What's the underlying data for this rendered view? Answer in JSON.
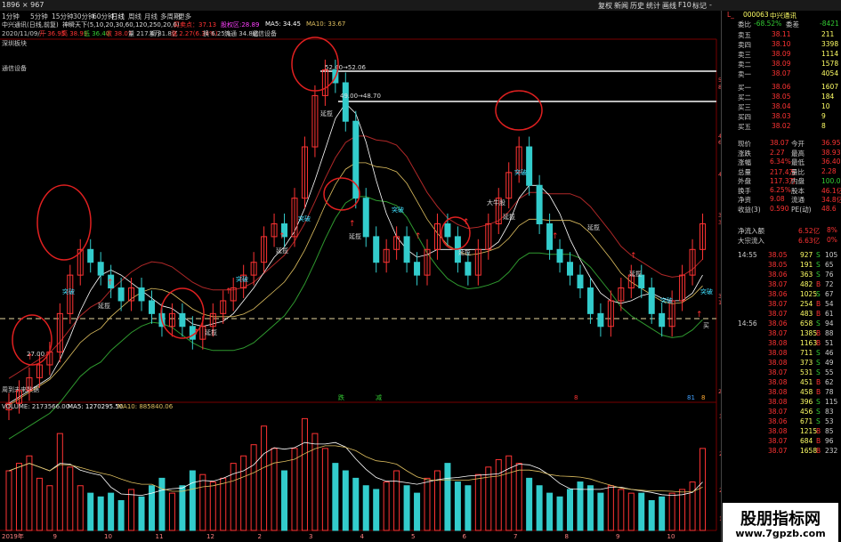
{
  "topbar": {
    "size": "1896 × 967",
    "menu": [
      "复权",
      "新闻",
      "历史",
      "统计",
      "画线",
      "F10",
      "标记",
      "-"
    ]
  },
  "timeframes": [
    "1分钟",
    "5分钟",
    "15分钟",
    "30分钟",
    "60分钟",
    "日线",
    "周线",
    "月线",
    "多周期",
    "更多"
  ],
  "ind1": {
    "name": "中兴通讯(日线,前复)",
    "rest": "神瞬天下(5,10,20,30,60,120,250,20,6)",
    "bar": "买卖点：37.13",
    "rebar": "股权区:28.89",
    "ma5": "MA5: 34.45",
    "ma10": "MA10: 33.67"
  },
  "ind2": {
    "date": "2020/11/09/一",
    "open": "开 36.95",
    "high": "高 38.93",
    "low": "低 36.40",
    "close": "收 38.07",
    "vol": "量 217.4万",
    "amt": "额 81.8亿",
    "chg": "涨 2.27(6.34%)",
    "turn": "换 6.25%",
    "cap": "流通 34.8亿",
    "tag": "通信设备"
  },
  "left_labels": {
    "a": "深圳板块",
    "b": "通信设备",
    "c": "周到未来数据"
  },
  "price_ticks": [
    "51.02",
    "80.8%",
    "47.70",
    "61.8%",
    "40.92",
    "37.06",
    "38.2%",
    "30.61",
    "19.1%",
    "24.57"
  ],
  "price_annot": {
    "h1": "52.40→52.06",
    "h2": "49.00→48.70",
    "l1": "27.00"
  },
  "tags": {
    "tp": "突破",
    "lg": "延揽",
    "dmz": "大牛股",
    "buy": "买",
    "ttc": "顶"
  },
  "bottom_flags": [
    "跌",
    "减",
    "8",
    "81",
    "8"
  ],
  "volume": {
    "label": "VOLUME: 2173566.00",
    "ma5": "MA5: 1270295.50",
    "ma10": "MA10: 885840.06",
    "ticks": [
      "30000",
      "25000",
      "20000",
      "15000"
    ]
  },
  "x_ticks": [
    "2019年",
    "9",
    "10",
    "11",
    "12",
    "2",
    "3",
    "4",
    "5",
    "6",
    "7",
    "8",
    "9",
    "10"
  ],
  "quote": {
    "code": "000063",
    "name": "中兴通讯",
    "ratio_label": "委比",
    "ratio": "-68.52%",
    "diff_label": "委差",
    "diff": "-8421",
    "asks": [
      {
        "n": "卖五",
        "p": "38.11",
        "v": "211"
      },
      {
        "n": "卖四",
        "p": "38.10",
        "v": "3398"
      },
      {
        "n": "卖三",
        "p": "38.09",
        "v": "1114"
      },
      {
        "n": "卖二",
        "p": "38.09",
        "v": "1578"
      },
      {
        "n": "卖一",
        "p": "38.07",
        "v": "4054"
      }
    ],
    "bids": [
      {
        "n": "买一",
        "p": "38.06",
        "v": "1607"
      },
      {
        "n": "买二",
        "p": "38.05",
        "v": "184"
      },
      {
        "n": "买三",
        "p": "38.04",
        "v": "10"
      },
      {
        "n": "买四",
        "p": "38.03",
        "v": "9"
      },
      {
        "n": "买五",
        "p": "38.02",
        "v": "8"
      }
    ],
    "stats": [
      [
        "现价",
        "38.07",
        "今开",
        "36.95"
      ],
      [
        "涨跌",
        "2.27",
        "最高",
        "38.93"
      ],
      [
        "涨幅",
        "6.34%",
        "最低",
        "36.40"
      ],
      [
        "总量",
        "217.4万",
        "量比",
        "2.28"
      ],
      [
        "外盘",
        "117.3万",
        "内盘",
        "100.0万"
      ],
      [
        "换手",
        "6.25%",
        "股本",
        "46.1亿"
      ],
      [
        "净资",
        "9.08",
        "流通",
        "34.8亿"
      ],
      [
        "收益(3)",
        "0.590",
        "PE(动)",
        "48.6"
      ]
    ],
    "flow": [
      [
        "净流入额",
        "6.52亿",
        "8%"
      ],
      [
        "大宗流入",
        "6.63亿",
        "0%"
      ]
    ],
    "ticks": [
      [
        "14:55",
        "38.05",
        "927",
        "S",
        "105"
      ],
      [
        "",
        "38.05",
        "191",
        "S",
        "65"
      ],
      [
        "",
        "38.06",
        "363",
        "S",
        "76"
      ],
      [
        "",
        "38.07",
        "482",
        "B",
        "72"
      ],
      [
        "",
        "38.06",
        "1025",
        "S",
        "67"
      ],
      [
        "",
        "38.07",
        "254",
        "B",
        "54"
      ],
      [
        "",
        "38.07",
        "483",
        "B",
        "61"
      ],
      [
        "14:56",
        "38.06",
        "658",
        "S",
        "94"
      ],
      [
        "",
        "38.07",
        "1385",
        "B",
        "88"
      ],
      [
        "",
        "38.08",
        "1163",
        "B",
        "51"
      ],
      [
        "",
        "38.08",
        "711",
        "S",
        "46"
      ],
      [
        "",
        "38.08",
        "373",
        "S",
        "49"
      ],
      [
        "",
        "38.07",
        "531",
        "S",
        "55"
      ],
      [
        "",
        "38.08",
        "451",
        "B",
        "62"
      ],
      [
        "",
        "38.08",
        "458",
        "B",
        "78"
      ],
      [
        "",
        "38.08",
        "396",
        "S",
        "115"
      ],
      [
        "",
        "38.07",
        "456",
        "S",
        "83"
      ],
      [
        "",
        "38.06",
        "671",
        "S",
        "53"
      ],
      [
        "",
        "38.08",
        "1215",
        "B",
        "85"
      ],
      [
        "",
        "38.07",
        "684",
        "B",
        "96"
      ],
      [
        "",
        "38.07",
        "1658",
        "B",
        "232"
      ]
    ]
  },
  "watermark": {
    "t1": "股朋指标网",
    "t2": "www.7gpzb.com"
  },
  "colors": {
    "up": "#ff3333",
    "down": "#33cccc",
    "ma_red": "#b02828",
    "ma_green": "#2f9a2f",
    "ma_yellow": "#e0c060"
  },
  "chart_data": {
    "type": "candlestick",
    "x_ticks": [
      "2019年",
      "9",
      "10",
      "11",
      "12",
      "2",
      "3",
      "4",
      "5",
      "6",
      "7",
      "8",
      "9",
      "10"
    ],
    "close": [
      24,
      25,
      26,
      27,
      28,
      31,
      34,
      36,
      35,
      34,
      33,
      32,
      33,
      32,
      31,
      30,
      31,
      30,
      29,
      30,
      31,
      32,
      33,
      34,
      35,
      37,
      38,
      37,
      40,
      44,
      48,
      50,
      49,
      46,
      40,
      37,
      35,
      36,
      37,
      35,
      34,
      36,
      38,
      37,
      35,
      34,
      36,
      38,
      40,
      42,
      44,
      41,
      38,
      36,
      35,
      34,
      33,
      31,
      30,
      32,
      33,
      34,
      33,
      31,
      30,
      32,
      34,
      36,
      38
    ],
    "volume": [
      1.6,
      1.8,
      2.0,
      1.4,
      1.2,
      2.6,
      1.7,
      1.2,
      1.0,
      0.9,
      1.0,
      0.8,
      1.1,
      0.9,
      1.2,
      1.4,
      1.0,
      1.2,
      1.6,
      1.5,
      1.3,
      1.4,
      1.8,
      2.0,
      2.3,
      2.8,
      2.2,
      1.6,
      2.2,
      3.0,
      2.6,
      2.2,
      1.8,
      1.6,
      1.4,
      1.2,
      1.1,
      1.3,
      1.6,
      1.2,
      1.0,
      1.4,
      1.6,
      1.8,
      1.3,
      1.2,
      1.5,
      1.7,
      1.9,
      2.0,
      1.8,
      1.4,
      1.2,
      1.0,
      0.9,
      1.1,
      1.3,
      1.2,
      1.0,
      1.2,
      1.1,
      1.0,
      1.0,
      0.8,
      0.9,
      1.0,
      1.1,
      1.3,
      2.2
    ],
    "ylim": [
      24.57,
      52.4
    ],
    "ma5": "MA5: 34.45",
    "ma10": "MA10: 33.67"
  }
}
